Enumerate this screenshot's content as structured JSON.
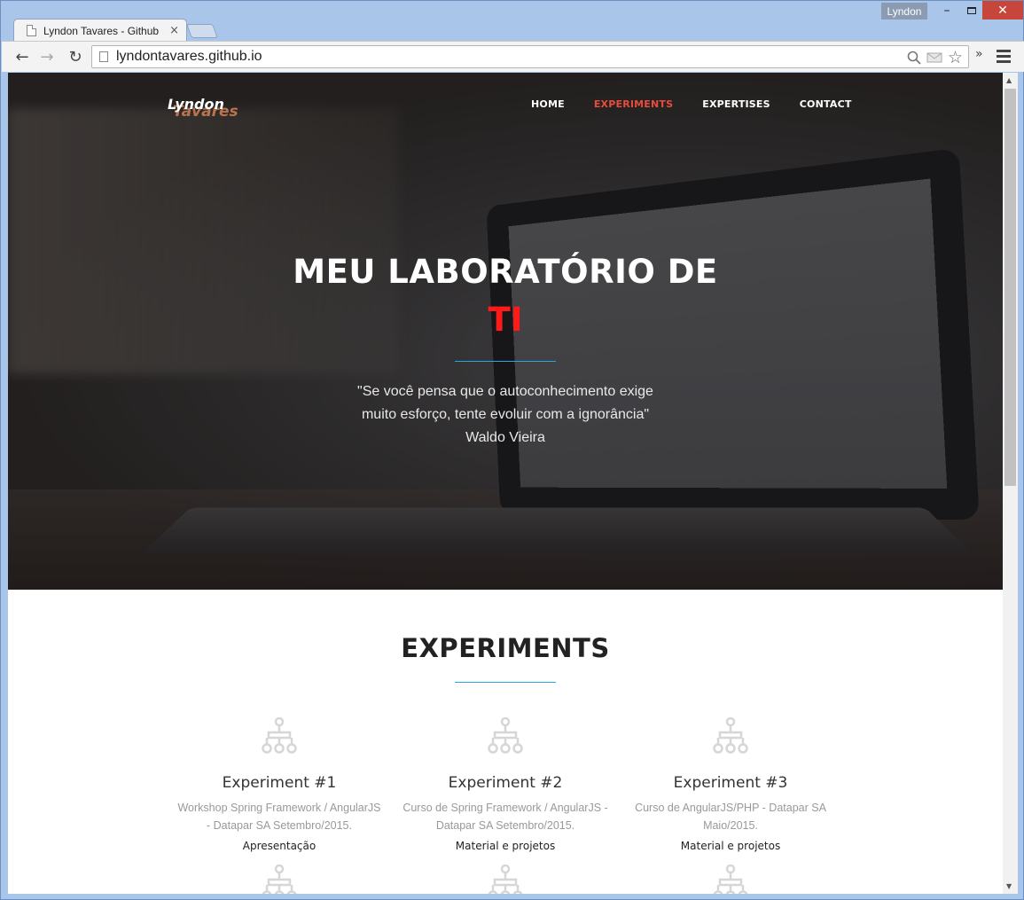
{
  "browser": {
    "tab_title": "Lyndon Tavares - Github",
    "tab_close": "×",
    "profile_name": "Lyndon",
    "url": "lyndontavares.github.io",
    "back_icon": "←",
    "forward_icon": "→",
    "reload_icon": "↻",
    "zoom_icon": "🔍",
    "star_icon": "☆",
    "extensions_icon": "»",
    "minimize_icon": "–",
    "close_icon": "✕"
  },
  "site": {
    "logo_line1": "Lyndon",
    "logo_line2": "Tavares",
    "nav": [
      {
        "label": "HOME",
        "active": false
      },
      {
        "label": "EXPERIMENTS",
        "active": true
      },
      {
        "label": "EXPERTISES",
        "active": false
      },
      {
        "label": "CONTACT",
        "active": false
      }
    ],
    "hero": {
      "title_line1": "MEU LABORATÓRIO DE",
      "title_line2": "TI",
      "quote_line1": "\"Se você pensa que o autoconhecimento exige",
      "quote_line2": "muito esforço, tente evoluir com a ignorância\"",
      "quote_author": "Waldo Vieira"
    },
    "experiments": {
      "title": "EXPERIMENTS",
      "items": [
        {
          "name": "Experiment #1",
          "desc_line1": "Workshop Spring Framework / AngularJS",
          "desc_line2": "- Datapar SA Setembro/2015.",
          "link": "Apresentação",
          "icon": "sitemap-icon"
        },
        {
          "name": "Experiment #2",
          "desc_line1": "Curso de Spring Framework / AngularJS -",
          "desc_line2": "Datapar SA Setembro/2015.",
          "link": "Material e projetos",
          "icon": "sitemap-icon"
        },
        {
          "name": "Experiment #3",
          "desc_line1": "Curso de AngularJS/PHP - Datapar SA",
          "desc_line2": "Maio/2015.",
          "link": "Material e projetos",
          "icon": "sitemap-icon"
        }
      ]
    },
    "colors": {
      "accent_red": "#ff1a1a",
      "nav_active": "#e74c3c",
      "divider_blue": "#27a9e0",
      "icon_gray": "#d6d6d6"
    }
  }
}
